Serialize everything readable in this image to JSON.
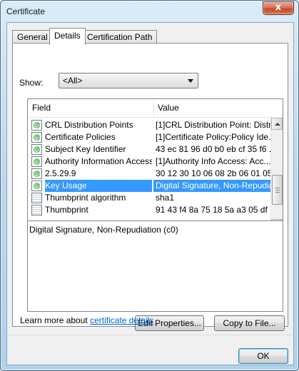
{
  "window": {
    "title": "Certificate",
    "close_label": "x"
  },
  "tabs": [
    {
      "label": "General",
      "active": false
    },
    {
      "label": "Details",
      "active": true
    },
    {
      "label": "Certification Path",
      "active": false
    }
  ],
  "show": {
    "label": "Show:",
    "selected": "<All>"
  },
  "grid": {
    "columns": [
      "Field",
      "Value"
    ],
    "rows": [
      {
        "field": "CRL Distribution Points",
        "value": "[1]CRL Distribution Point: Distr...",
        "icon": "cert-extension-icon",
        "selected": false
      },
      {
        "field": "Certificate Policies",
        "value": "[1]Certificate Policy:Policy Ide...",
        "icon": "cert-extension-icon",
        "selected": false
      },
      {
        "field": "Subject Key Identifier",
        "value": "43 ec 81 96 d0 b0 eb cf 35 f6 ...",
        "icon": "cert-extension-icon",
        "selected": false
      },
      {
        "field": "Authority Information Access",
        "value": "[1]Authority Info Access: Acc...",
        "icon": "cert-extension-icon",
        "selected": false
      },
      {
        "field": "2.5.29.9",
        "value": "30 12 30 10 06 08 2b 06 01 05...",
        "icon": "cert-extension-icon",
        "selected": false
      },
      {
        "field": "Key Usage",
        "value": "Digital Signature, Non-Repudia...",
        "icon": "cert-extension-icon",
        "selected": true
      },
      {
        "field": "Thumbprint algorithm",
        "value": "sha1",
        "icon": "property-icon",
        "selected": false
      },
      {
        "field": "Thumbprint",
        "value": "91 43 f4 8a 75 18 5a a3 05 df ...",
        "icon": "property-icon",
        "selected": false
      }
    ]
  },
  "detail_text": "Digital Signature, Non-Repudiation (c0)",
  "buttons": {
    "edit_properties": "Edit Properties...",
    "copy_to_file": "Copy to File...",
    "ok": "OK"
  },
  "learn": {
    "prefix": "Learn more about ",
    "link": "certificate details"
  }
}
